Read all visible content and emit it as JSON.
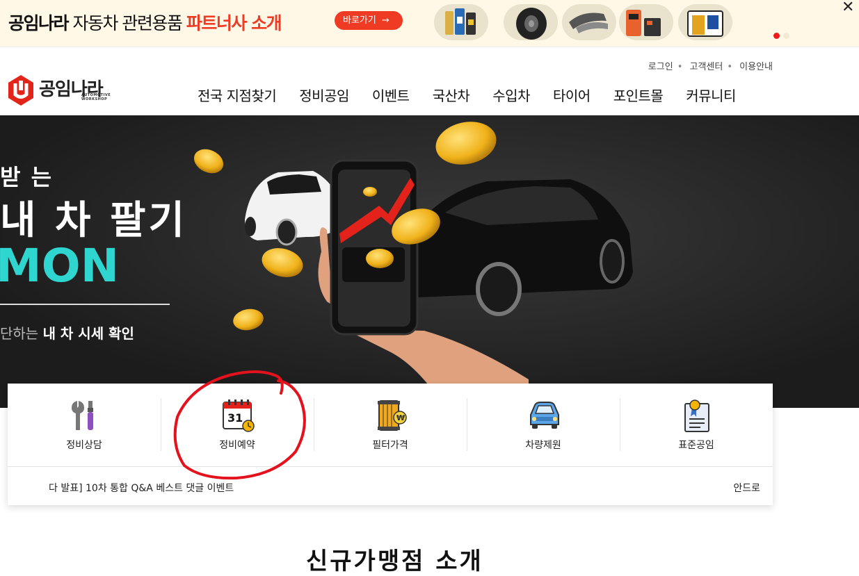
{
  "promo": {
    "brand": "공임나라",
    "mid": " 자동차 관련용품 ",
    "highlight": "파트너사 소개",
    "button": "바로가기",
    "button_arrow": "→",
    "close": "✕",
    "products": [
      "engine-oil-icon",
      "tire-icon",
      "brake-pad-icon",
      "battery-charger-icon",
      "oil-filter-icon"
    ],
    "accent_color": "#ef3a24"
  },
  "header": {
    "util": [
      "로그인",
      "고객센터",
      "이용안내"
    ],
    "util_sep": "•",
    "logo_text": "공임나라",
    "logo_sub_1": "AUTOMOTIVE",
    "logo_sub_2": "WORKSHOP",
    "nav": [
      "전국 지점찾기",
      "정비공임",
      "이벤트",
      "국산차",
      "수입차",
      "타이어",
      "포인트몰",
      "커뮤니티"
    ]
  },
  "hero": {
    "line1": "받 는",
    "line2": "내 차 팔기",
    "line3": "MON",
    "sub_plain": "단하는 ",
    "sub_bold": "내 차 시세 확인",
    "accent_color": "#2fd6d0"
  },
  "quick": {
    "items": [
      {
        "label": "정비상담",
        "icon": "wrench-icon"
      },
      {
        "label": "정비예약",
        "icon": "calendar-icon",
        "icon_text": "31"
      },
      {
        "label": "필터가격",
        "icon": "filter-price-icon",
        "icon_text": "₩"
      },
      {
        "label": "차량제원",
        "icon": "car-spec-icon"
      },
      {
        "label": "표준공임",
        "icon": "certificate-icon"
      }
    ],
    "notice": "다 발표] 10차 통합 Q&A 베스트 댓글 이벤트",
    "right_text": "안드로"
  },
  "below": {
    "title": "신규가맹점 소개"
  }
}
